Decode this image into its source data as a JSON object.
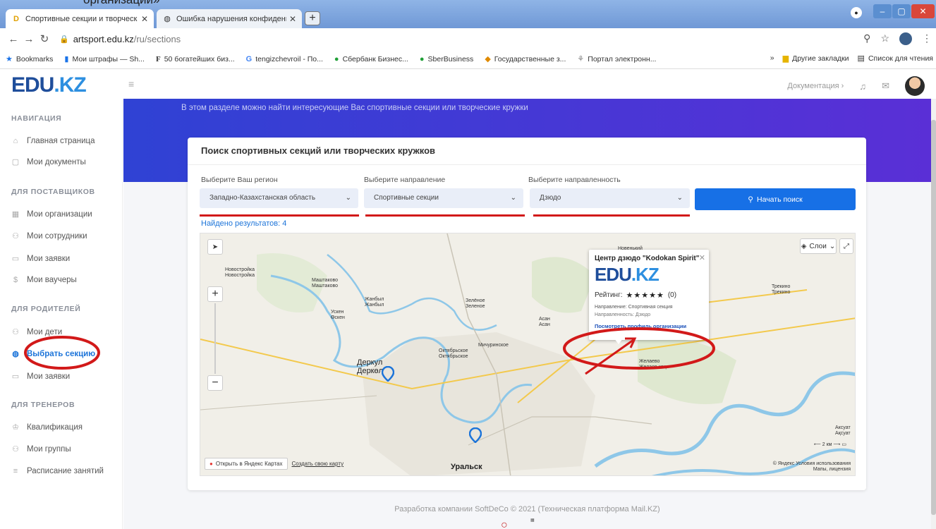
{
  "caption": "организации»",
  "browser": {
    "tabs": [
      {
        "label": "Спортивные секции и творческ",
        "icon": "edu-favicon-icon"
      },
      {
        "label": "Ошибка нарушения конфиденц",
        "icon": "globe-icon"
      }
    ],
    "url_host": "artsport.edu.kz",
    "url_path": "/ru/sections",
    "bookmarks": [
      "Bookmarks",
      "Мои штрафы — Sh...",
      "50 богатейших биз...",
      "tengizchevroil - По...",
      "Сбербанк Бизнес...",
      "SberBusiness",
      "Государственные з...",
      "Портал электронн..."
    ],
    "bookmarks_right": [
      "Другие закладки",
      "Список для чтения"
    ]
  },
  "header": {
    "logo_main": "EDU",
    "logo_dot": ".",
    "logo_kz": "KZ",
    "docs_link": "Документация ›"
  },
  "sidebar": {
    "sections": [
      {
        "title": "НАВИГАЦИЯ",
        "items": [
          "Главная страница",
          "Мои документы"
        ]
      },
      {
        "title": "ДЛЯ ПОСТАВЩИКОВ",
        "items": [
          "Мои организации",
          "Мои сотрудники",
          "Мои заявки",
          "Мои ваучеры"
        ]
      },
      {
        "title": "ДЛЯ РОДИТЕЛЕЙ",
        "items": [
          "Мои дети",
          "Выбрать секцию",
          "Мои заявки"
        ]
      },
      {
        "title": "ДЛЯ ТРЕНЕРОВ",
        "items": [
          "Квалификация",
          "Мои группы",
          "Расписание занятий"
        ]
      }
    ],
    "active_item": "Выбрать секцию"
  },
  "banner": {
    "text": "В этом разделе можно найти интересующие Вас спортивные секции или творческие кружки"
  },
  "search": {
    "title": "Поиск спортивных секций или творческих кружков",
    "region_label": "Выберите Ваш регион",
    "region_value": "Западно-Казахстанская область",
    "direction_label": "Выберите направление",
    "direction_value": "Спортивные секции",
    "focus_label": "Выберите направленность",
    "focus_value": "Дзюдо",
    "button_label": "Начать поиск",
    "found_text": "Найдено результатов: 4"
  },
  "map": {
    "layers_label": "Слои",
    "labels": {
      "novostroyka": "Новостройка\nНовостройка",
      "mashtakovo": "Маштаково\nМаштаково",
      "zhanbyl": "Жанбыл\nЖанбыл",
      "uskhen": "Ускен\nӨскен",
      "zelenoe": "Зелёное\nЗеленое",
      "asan": "Асан\nАсан",
      "oktyabrskoe": "Октябрьское\nОктябрьское",
      "michurinskoe": "Мичуринское",
      "derkul": "Деркул\nДеркөл",
      "uralsk": "Уральск",
      "zhelaevo": "Желаево\nЖелаев кеңе",
      "trekino": "Трекино\nТрекино",
      "novenkiy": "Новенький",
      "aksuat": "Аксуат\nАқсуат"
    },
    "open_yandex": "Открыть в Яндекс Картах",
    "create_map": "Создать свою карту",
    "scale": "2 км",
    "attribution": "© Яндекс Условия использования",
    "attribution2": "Мапы, лицензия",
    "popup": {
      "title": "Центр дзюдо \"Kodokan Spirit\"",
      "logo_main": "EDU",
      "logo_dot": ".",
      "logo_kz": "KZ",
      "rating_label": "Рейтинг:",
      "stars": "★★★★★",
      "rating_count": "(0)",
      "direction": "Направление: Спортивная секция",
      "focus": "Направленность: Дзюдо",
      "link": "Посмотреть профиль организации"
    }
  },
  "footer": {
    "text": "Разработка компании SoftDeCo © 2021 (Техническая платформа Mail.KZ)"
  },
  "colors": {
    "brand_blue": "#1770e6",
    "banner_start": "#2f42d4",
    "banner_end": "#5a2fd6",
    "annotation_red": "#d21919"
  }
}
